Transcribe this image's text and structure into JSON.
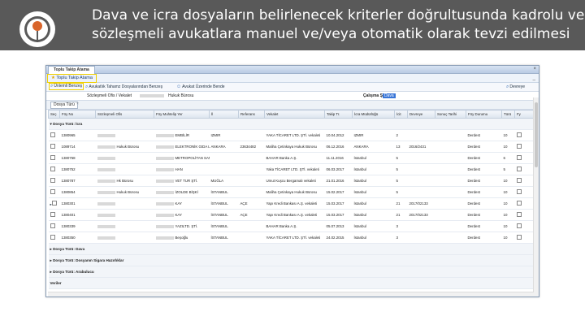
{
  "slide": {
    "headline_line1": "Dava ve icra dosyaların belirlenecek kriterler doğrultusunda kadrolu ve",
    "headline_line2": "sözleşmeli avukatlara manuel ve/veya otomatik olarak tevzi edilmesi"
  },
  "window": {
    "tab_title": "Toplu Takip Atama",
    "close_glyph": "×",
    "module_title": "Toplu Takip Atama",
    "minimize_glyph": "_"
  },
  "toolbar": {
    "btn1": "Ünlemli Benzeş",
    "btn2": "Avukatlık Tahamz Dosyalarından Benzeş",
    "btn3": "Avukat Üzerinde Bende",
    "btn4": "Devreye"
  },
  "filter": {
    "label": "Sözleşmeli Ofis / Vekalet",
    "unit": "Hukuk Bürosu",
    "work_label": "Çalışma Şekli",
    "work_value": "Dava"
  },
  "panel": {
    "button": "Dosya Türü",
    "close": "×"
  },
  "grid": {
    "headers": [
      "Seç",
      "Föy No",
      "Sözleşmeli Ofis",
      "Föy Muhtelip Yer",
      "İl",
      "Referans",
      "Vekalet",
      "Takip Tr.",
      "İcra Müdürlüğü",
      "İcit",
      "Devreye",
      "Sonuç Tarihi",
      "Föy Durumu",
      "Türü",
      "Fy"
    ],
    "group1": "Dosya Türü: İcra",
    "rows": [
      {
        "no": "1380965",
        "office": "",
        "place": "EMBİLİR",
        "il": "IZMIR",
        "ref": "",
        "vek": "YAKA TİCARET LTD. ŞTİ. vekaleti",
        "tarih": "10.04.2012",
        "mud": "IZMIR",
        "icit": "2",
        "dev": "",
        "sonuc": "",
        "durum": "Derdest",
        "turu": "10",
        "mark": ""
      },
      {
        "no": "1089714",
        "office": "Hukuk Bürosu",
        "place": "ELEKTRONİK GIDA LTD.",
        "il": "ANKARA",
        "ref": "23634482",
        "vek": "Maliha Çetinkaya Hukuk Bürosu",
        "tarih": "06.12.2016",
        "mud": "ANKARA",
        "icit": "13",
        "dev": "2016/2431",
        "sonuc": "",
        "durum": "Derdest",
        "turu": "10",
        "mark": ""
      },
      {
        "no": "1380758",
        "office": "",
        "place": "METROPOLİTAN SANAYİ TİC. ŞTİ. İLAÇ",
        "il": "",
        "ref": "",
        "vek": "BAHAR Banka A.Ş.",
        "tarih": "11.11.2016",
        "mud": "İstanbul",
        "icit": "5",
        "dev": "",
        "sonuc": "",
        "durum": "Derdest",
        "turu": "6",
        "mark": ""
      },
      {
        "no": "1380752",
        "office": "",
        "place": "HAN",
        "il": "",
        "ref": "",
        "vek": "Yaka TİCARET LTD. ŞTİ. vekaleti",
        "tarih": "06.03.2017",
        "mud": "İstanbul",
        "icit": "5",
        "dev": "",
        "sonuc": "",
        "durum": "Derdest",
        "turu": "5",
        "mark": ""
      },
      {
        "no": "1380787",
        "office": "Hk Bürosu",
        "place": "VET TUR ŞTİ.",
        "il": "MUĞLA",
        "ref": "",
        "vek": "Umut Kuşcu Bergamalı vekaleti",
        "tarih": "21.01.2016",
        "mud": "İstanbul",
        "icit": "5",
        "dev": "",
        "sonuc": "",
        "durum": "Derdest",
        "turu": "10",
        "mark": ""
      },
      {
        "no": "1380854",
        "office": "Hukuk Bürosu",
        "place": "İZOLDE BİŞKİ",
        "il": "İSTANBUL",
        "ref": "",
        "vek": "Maliha Çetinkaya Hukuk Bürosu",
        "tarih": "15.02.2017",
        "mud": "İstanbul",
        "icit": "5",
        "dev": "",
        "sonuc": "",
        "durum": "Derdest",
        "turu": "10",
        "mark": ""
      },
      {
        "no": "1380301",
        "office": "",
        "place": "KAY",
        "il": "İSTANBUL",
        "ref": "AÇE",
        "vek": "Yapı Kredi Bankası A.Ş. vekaleti",
        "tarih": "15.03.2017",
        "mud": "İstanbul",
        "icit": "21",
        "dev": "2017/02133",
        "sonuc": "",
        "durum": "Derdest",
        "turu": "10",
        "mark": "▸"
      },
      {
        "no": "1380401",
        "office": "",
        "place": "KAY",
        "il": "İSTANBUL",
        "ref": "AÇE",
        "vek": "Yapı Kredi Bankası A.Ş. vekaleti",
        "tarih": "15.03.2017",
        "mud": "İstanbul",
        "icit": "21",
        "dev": "2017/02133",
        "sonuc": "",
        "durum": "Derdest",
        "turu": "10",
        "mark": ""
      },
      {
        "no": "1380339",
        "office": "",
        "place": "YAZILTD. ŞTİ.",
        "il": "İSTANBUL",
        "ref": "",
        "vek": "BAHAR Banka A.Ş.",
        "tarih": "05.07.2013",
        "mud": "İstanbul",
        "icit": "3",
        "dev": "",
        "sonuc": "",
        "durum": "Derdest",
        "turu": "10",
        "mark": ""
      },
      {
        "no": "1380350",
        "office": "",
        "place": "Beşoğlu",
        "il": "İSTANBUL",
        "ref": "",
        "vek": "YAKA TİCARET LTD. ŞTİ. vekaleti",
        "tarih": "24.02.2015",
        "mud": "İstanbul",
        "icit": "3",
        "dev": "",
        "sonuc": "",
        "durum": "Derdest",
        "turu": "10",
        "mark": ""
      }
    ],
    "group2": "Dosya Türü: Dava",
    "group3": "Dosya Türü: Dosyanın Sigara Hazırlıklar",
    "group4": "Dosya Türü: Arabulucu",
    "footer": "Veriler"
  }
}
